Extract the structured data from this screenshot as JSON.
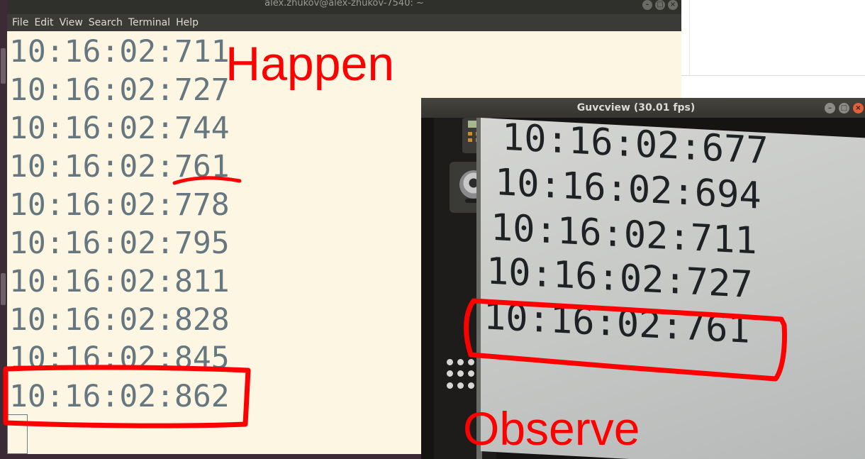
{
  "terminal": {
    "title": "alex.zhukov@alex-zhukov-7540: ~",
    "menu": [
      "File",
      "Edit",
      "View",
      "Search",
      "Terminal",
      "Help"
    ],
    "lines": [
      "10:16:02:711",
      "10:16:02:727",
      "10:16:02:744",
      "10:16:02:761",
      "10:16:02:778",
      "10:16:02:795",
      "10:16:02:811",
      "10:16:02:828",
      "10:16:02:845",
      "10:16:02:862"
    ]
  },
  "guvcview": {
    "title": "Guvcview  (30.01 fps)",
    "camera_lines": [
      "10:16:02:677",
      "10:16:02:694",
      "10:16:02:711",
      "10:16:02:727",
      "10:16:02:761"
    ]
  },
  "annotations": {
    "happen": "Happen",
    "observe": "Observe",
    "color": "#ff0000"
  },
  "icons": {
    "window_close": "×",
    "window_min": "–",
    "window_max": "□"
  }
}
